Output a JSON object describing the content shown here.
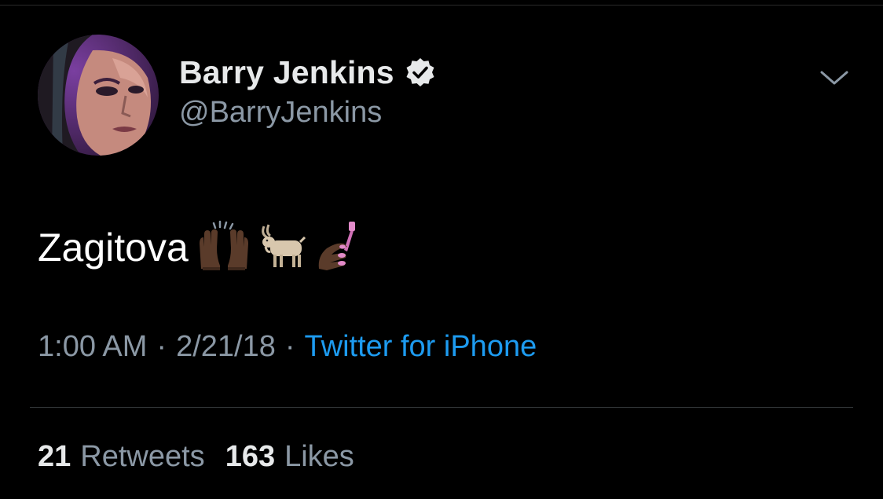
{
  "user": {
    "display_name": "Barry Jenkins",
    "handle": "@BarryJenkins",
    "verified": true,
    "avatar_icon": "portrait-avatar"
  },
  "tweet": {
    "text": "Zagitova",
    "emojis": [
      "raising-hands-dark-skin",
      "goat",
      "nail-polish-dark-skin"
    ]
  },
  "meta": {
    "time": "1:00 AM",
    "separator": "·",
    "date": "2/21/18",
    "source": "Twitter for iPhone"
  },
  "stats": {
    "retweets_count": "21",
    "retweets_label": "Retweets",
    "likes_count": "163",
    "likes_label": "Likes"
  },
  "colors": {
    "background": "#000000",
    "primary_text": "#e7e9ea",
    "secondary_text": "#8b98a5",
    "link": "#1d9bf0"
  }
}
